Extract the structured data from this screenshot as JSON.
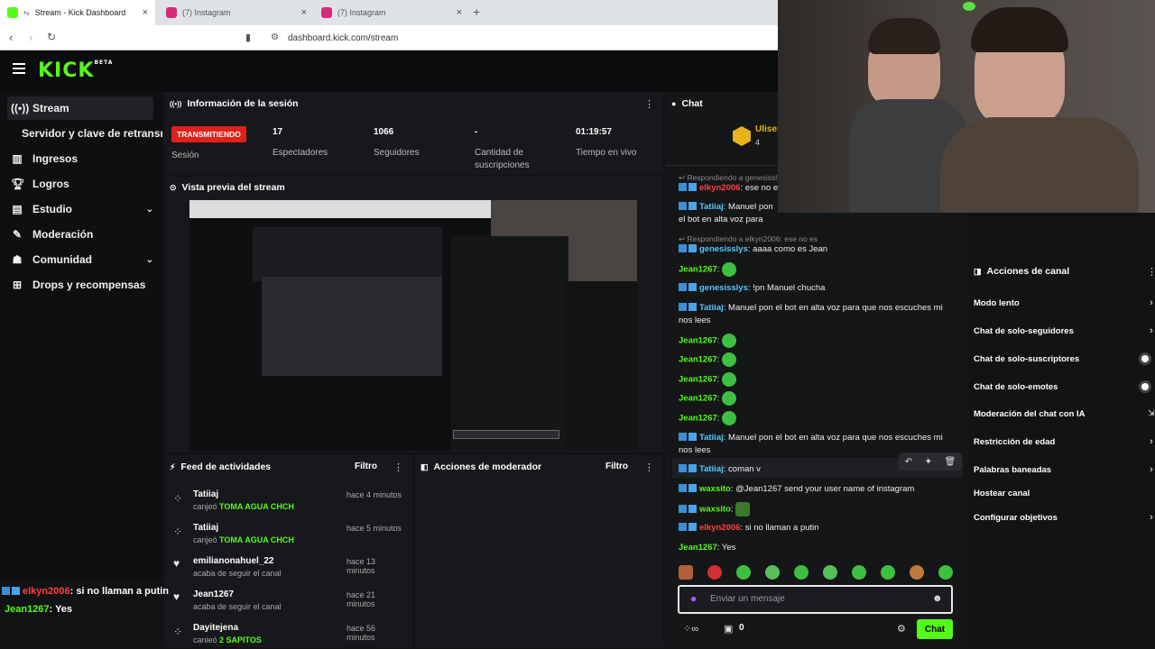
{
  "browser": {
    "tabs": [
      {
        "title": "Stream - Kick Dashboard",
        "close": "×"
      },
      {
        "title": "(7) Instagram",
        "close": "×"
      },
      {
        "title": "(7) Instagram",
        "close": "×"
      }
    ],
    "new_tab": "+",
    "url": "dashboard.kick.com/stream"
  },
  "kick": {
    "logo": "KICK",
    "beta": "BETA"
  },
  "sidebar": {
    "items": [
      {
        "label": "Stream",
        "icon": "broadcast-icon"
      },
      {
        "label": "Servidor y clave de retransmisión",
        "icon": ""
      },
      {
        "label": "Ingresos",
        "icon": "chart-icon"
      },
      {
        "label": "Logros",
        "icon": "trophy-icon"
      },
      {
        "label": "Estudio",
        "icon": "studio-icon"
      },
      {
        "label": "Moderación",
        "icon": "wrench-icon"
      },
      {
        "label": "Comunidad",
        "icon": "community-icon"
      },
      {
        "label": "Drops y recompensas",
        "icon": "drops-icon"
      }
    ]
  },
  "session": {
    "title": "Información de la sesión",
    "live_badge": "TRANSMITIENDO",
    "status_label": "Sesión",
    "stats": [
      {
        "value": "17",
        "label": "Espectadores"
      },
      {
        "value": "1066",
        "label": "Seguidores"
      },
      {
        "value": "-",
        "label": "Cantidad de suscripciones"
      },
      {
        "value": "01:19:57",
        "label": "Tiempo en vivo"
      }
    ]
  },
  "preview": {
    "title": "Vista previa del stream"
  },
  "activity": {
    "title": "Feed de actividades",
    "filter": "Filtro",
    "items": [
      {
        "name": "Tatiiaj",
        "action": "canjeó",
        "reward": "TOMA AGUA CHCH",
        "time": "hace 4 minutos"
      },
      {
        "name": "Tatiiaj",
        "action": "canjeó",
        "reward": "TOMA AGUA CHCH",
        "time": "hace 5 minutos"
      },
      {
        "name": "emilianonahuel_22",
        "action": "acaba de seguir el canal",
        "reward": "",
        "time": "hace 13 minutos"
      },
      {
        "name": "Jean1267",
        "action": "acaba de seguir el canal",
        "reward": "",
        "time": "hace 21 minutos"
      },
      {
        "name": "Dayitejena",
        "action": "canjeó",
        "reward": "2 SAPITOS",
        "time": "hace 56 minutos"
      }
    ]
  },
  "moderator": {
    "title": "Acciones de moderador",
    "filter": "Filtro"
  },
  "chat": {
    "title": "Chat",
    "pinned_user": "Ulises",
    "pinned_count": "4",
    "input_placeholder": "Enviar un mensaje",
    "send": "Chat",
    "viewer_count": "0",
    "messages": [
      {
        "reply": "Respondiendo a genesisslys: ...",
        "user": "",
        "text": ""
      },
      {
        "user": "elkyn2006",
        "color": "red",
        "text": "ese no es"
      },
      {
        "user": "Tatiiaj",
        "color": "blue",
        "text": "Manuel pon el bot en alta voz para que nos escuches mi nos lees"
      },
      {
        "reply": "Respondiendo a elkyn2006: ese no es"
      },
      {
        "user": "genesisslys",
        "color": "blue",
        "text": "aaaa como es Jean"
      },
      {
        "user": "Jean1267",
        "color": "green",
        "text": ""
      },
      {
        "user": "genesisslys",
        "color": "blue",
        "text": "!pn Manuel chucha"
      },
      {
        "user": "Tatiiaj",
        "color": "blue",
        "text": "Manuel pon el bot en alta voz para que nos escuches mi nos lees"
      },
      {
        "user": "Jean1267",
        "color": "green",
        "text": ""
      },
      {
        "user": "Jean1267",
        "color": "green",
        "text": ""
      },
      {
        "user": "Jean1267",
        "color": "green",
        "text": ""
      },
      {
        "user": "Jean1267",
        "color": "green",
        "text": ""
      },
      {
        "user": "Jean1267",
        "color": "green",
        "text": ""
      },
      {
        "user": "Tatiiaj",
        "color": "blue",
        "text": "Manuel pon el bot en alta voz para que nos escuches mi nos lees"
      },
      {
        "user": "Tatiiaj",
        "color": "blue",
        "text": "coman v"
      },
      {
        "user": "waxsito",
        "color": "green",
        "text": "@Jean1267 send your user name of instagram"
      },
      {
        "user": "waxsito",
        "color": "green",
        "text": ""
      },
      {
        "user": "elkyn2006",
        "color": "red",
        "text": "si no llaman a putin"
      },
      {
        "user": "Jean1267",
        "color": "green",
        "text": "Yes"
      }
    ]
  },
  "channel_actions": {
    "title": "Acciones de canal",
    "items": [
      {
        "label": "Modo lento",
        "control": "chevron"
      },
      {
        "label": "Chat de solo-seguidores",
        "control": "chevron"
      },
      {
        "label": "Chat de solo-suscriptores",
        "control": "toggle"
      },
      {
        "label": "Chat de solo-emotes",
        "control": "toggle"
      },
      {
        "label": "Moderación del chat con IA",
        "control": "chevron"
      },
      {
        "label": "Restricción de edad",
        "control": "chevron"
      },
      {
        "label": "Palabras baneadas",
        "control": "chevron"
      },
      {
        "label": "Hostear canal",
        "control": ""
      },
      {
        "label": "Configurar objetivos",
        "control": "chevron"
      }
    ]
  },
  "overlay_chat": [
    {
      "user": "elkyn2006",
      "text": ": si no llaman a putin"
    },
    {
      "user": "Jean1267",
      "text": ": Yes"
    }
  ],
  "colors": {
    "brand": "#53fc18",
    "live": "#e0201b"
  }
}
